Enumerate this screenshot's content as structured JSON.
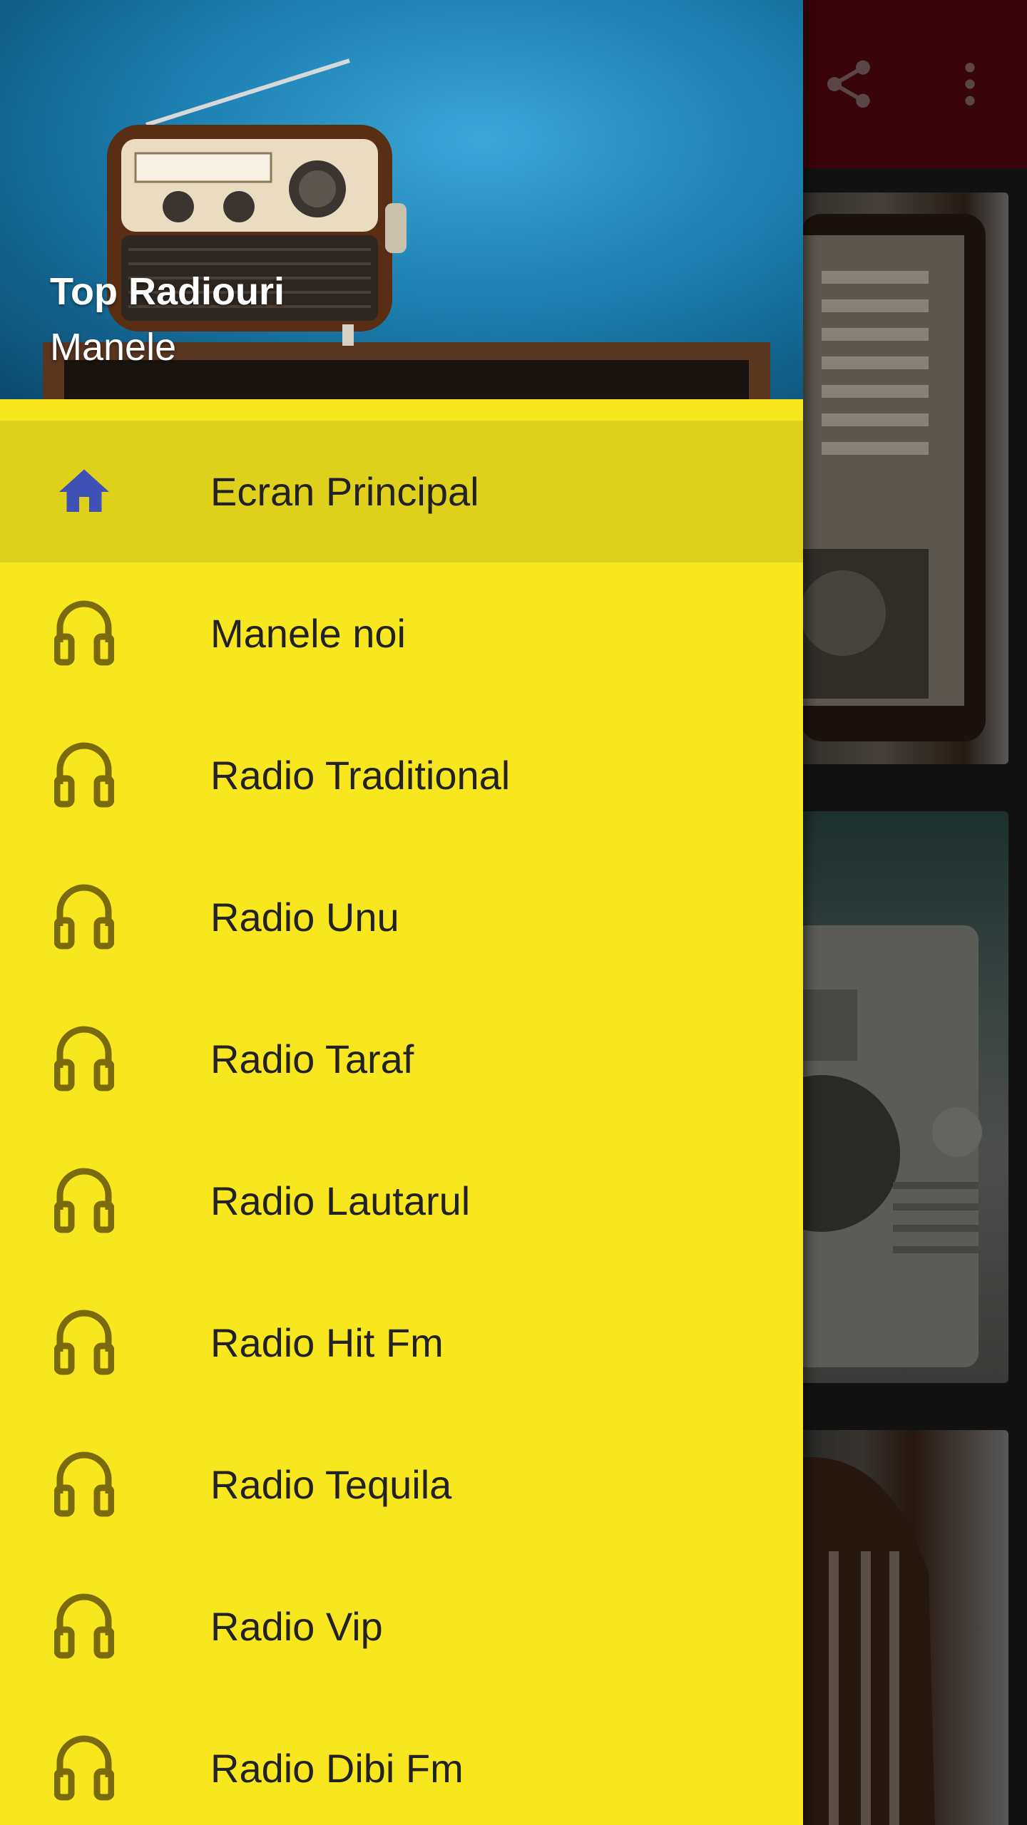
{
  "drawer": {
    "title": "Top Radiouri",
    "subtitle": "Manele",
    "items": [
      {
        "label": "Ecran Principal",
        "icon": "home-icon",
        "active": true
      },
      {
        "label": "Manele noi",
        "icon": "headphones-icon"
      },
      {
        "label": "Radio Traditional",
        "icon": "headphones-icon"
      },
      {
        "label": "Radio Unu",
        "icon": "headphones-icon"
      },
      {
        "label": "Radio Taraf",
        "icon": "headphones-icon"
      },
      {
        "label": "Radio Lautarul",
        "icon": "headphones-icon"
      },
      {
        "label": "Radio Hit Fm",
        "icon": "headphones-icon"
      },
      {
        "label": "Radio Tequila",
        "icon": "headphones-icon"
      },
      {
        "label": "Radio Vip",
        "icon": "headphones-icon"
      },
      {
        "label": "Radio Dibi Fm",
        "icon": "headphones-icon"
      }
    ]
  },
  "appbar": {
    "actions": [
      "share-icon",
      "more-vert-icon"
    ]
  },
  "colors": {
    "drawer_background": "#f8e71f",
    "active_item": "#dfd01c",
    "home_icon": "#3f51b5",
    "headphones_icon": "#7a6a0e",
    "appbar": "#5a0712"
  }
}
